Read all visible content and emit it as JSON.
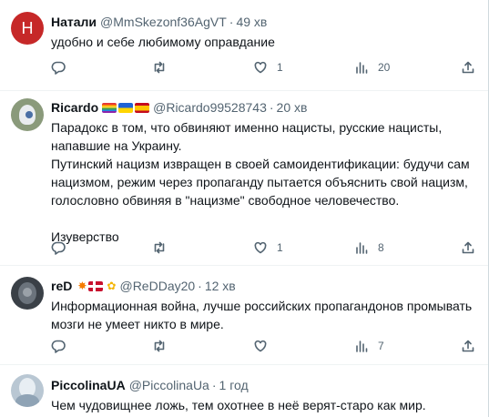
{
  "replies": [
    {
      "name": "Натали",
      "handle": "@MmSkezonf36AgVT",
      "time": "49 хв",
      "avatar_letter": "Н",
      "avatar_color": "#c62828",
      "text": "удобно и себе любимому оправдание",
      "stats": {
        "reply": "",
        "retweet": "",
        "like": "1",
        "views": "20"
      }
    },
    {
      "name": "Ricardo",
      "handle": "@Ricardo99528743",
      "time": "20 хв",
      "avatar_color": "#8a9a7b",
      "flags": [
        "rainbow-flag",
        "ukraine-flag",
        "spain-flag"
      ],
      "text": "Парадокс в том, что обвиняют именно нацисты, русские нацисты, напавшие на Украину.\nПутинский нацизм извращен в своей самоидентификации: будучи сам нацизмом, режим через пропаганду пытается объяснить свой нацизм, голословно обвиняя в \"нацизме\" свободное человечество.\n\nИзуверство",
      "stats": {
        "reply": "",
        "retweet": "",
        "like": "1",
        "views": "8"
      }
    },
    {
      "name": "reD",
      "handle": "@ReDDay20",
      "time": "12 хв",
      "avatar_color": "#3a4047",
      "flags": [
        "explosion-emoji",
        "denmark-flag",
        "sunflower-emoji"
      ],
      "text": "Информационная война, лучше российских пропагандонов промывать мозги не умеет никто в мире.",
      "stats": {
        "reply": "",
        "retweet": "",
        "like": "",
        "views": "7"
      }
    },
    {
      "name": "PiccolinaUA",
      "handle": "@PiccolinaUa",
      "time": "1 год",
      "avatar_color": "#b9c7d3",
      "text": "Чем чудовищнее ложь, тем охотнее в неё верят-старо как мир."
    }
  ],
  "colors": {
    "text": "#0f1419",
    "muted": "#536471",
    "divider": "#eff3f4"
  }
}
